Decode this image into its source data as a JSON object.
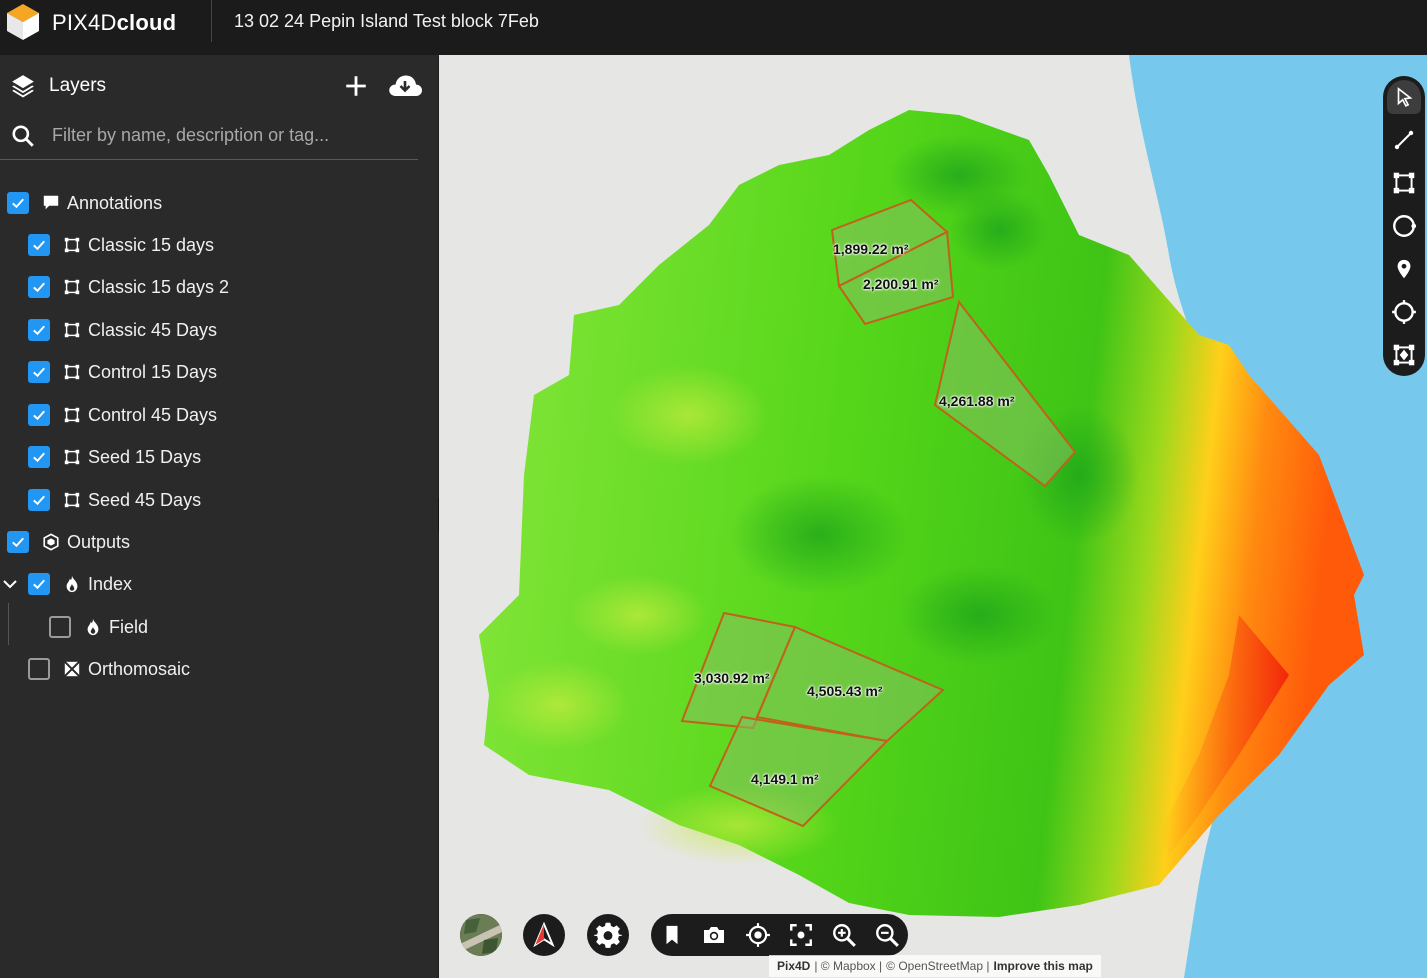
{
  "app": {
    "brand_light": "PIX4D",
    "brand_bold": "cloud",
    "project_title": "13 02 24 Pepin Island Test block 7Feb"
  },
  "layers": {
    "title": "Layers",
    "search_placeholder": "Filter by name, description or tag...",
    "items": [
      {
        "label": "Annotations",
        "checked": true,
        "icon": "annotation-icon"
      },
      {
        "label": "Classic 15 days",
        "checked": true,
        "icon": "polygon-icon"
      },
      {
        "label": "Classic 15 days 2",
        "checked": true,
        "icon": "polygon-icon"
      },
      {
        "label": "Classic 45 Days",
        "checked": true,
        "icon": "polygon-icon"
      },
      {
        "label": "Control 15 Days",
        "checked": true,
        "icon": "polygon-icon"
      },
      {
        "label": "Control 45 Days",
        "checked": true,
        "icon": "polygon-icon"
      },
      {
        "label": "Seed 15 Days",
        "checked": true,
        "icon": "polygon-icon"
      },
      {
        "label": "Seed 45 Days",
        "checked": true,
        "icon": "polygon-icon"
      },
      {
        "label": "Outputs",
        "checked": true,
        "icon": "outputs-cube-icon"
      },
      {
        "label": "Index",
        "checked": true,
        "icon": "index-flame-icon"
      },
      {
        "label": "Field",
        "checked": false,
        "icon": "index-flame-icon"
      },
      {
        "label": "Orthomosaic",
        "checked": false,
        "icon": "orthomosaic-icon"
      }
    ]
  },
  "map": {
    "areas": [
      {
        "label": "1,899.22 m²"
      },
      {
        "label": "2,200.91 m²"
      },
      {
        "label": "4,261.88 m²"
      },
      {
        "label": "3,030.92 m²"
      },
      {
        "label": "4,505.43 m²"
      },
      {
        "label": "4,149.1 m²"
      }
    ],
    "attribution": {
      "pix4d": "Pix4D",
      "mapbox": "| © Mapbox |",
      "osm": "© OpenStreetMap |",
      "improve": "Improve this map"
    }
  },
  "colors": {
    "accent": "#2196f3",
    "water": "#76c9ec",
    "land": "#e6e6e4",
    "polygon_stroke": "#c0621a"
  }
}
